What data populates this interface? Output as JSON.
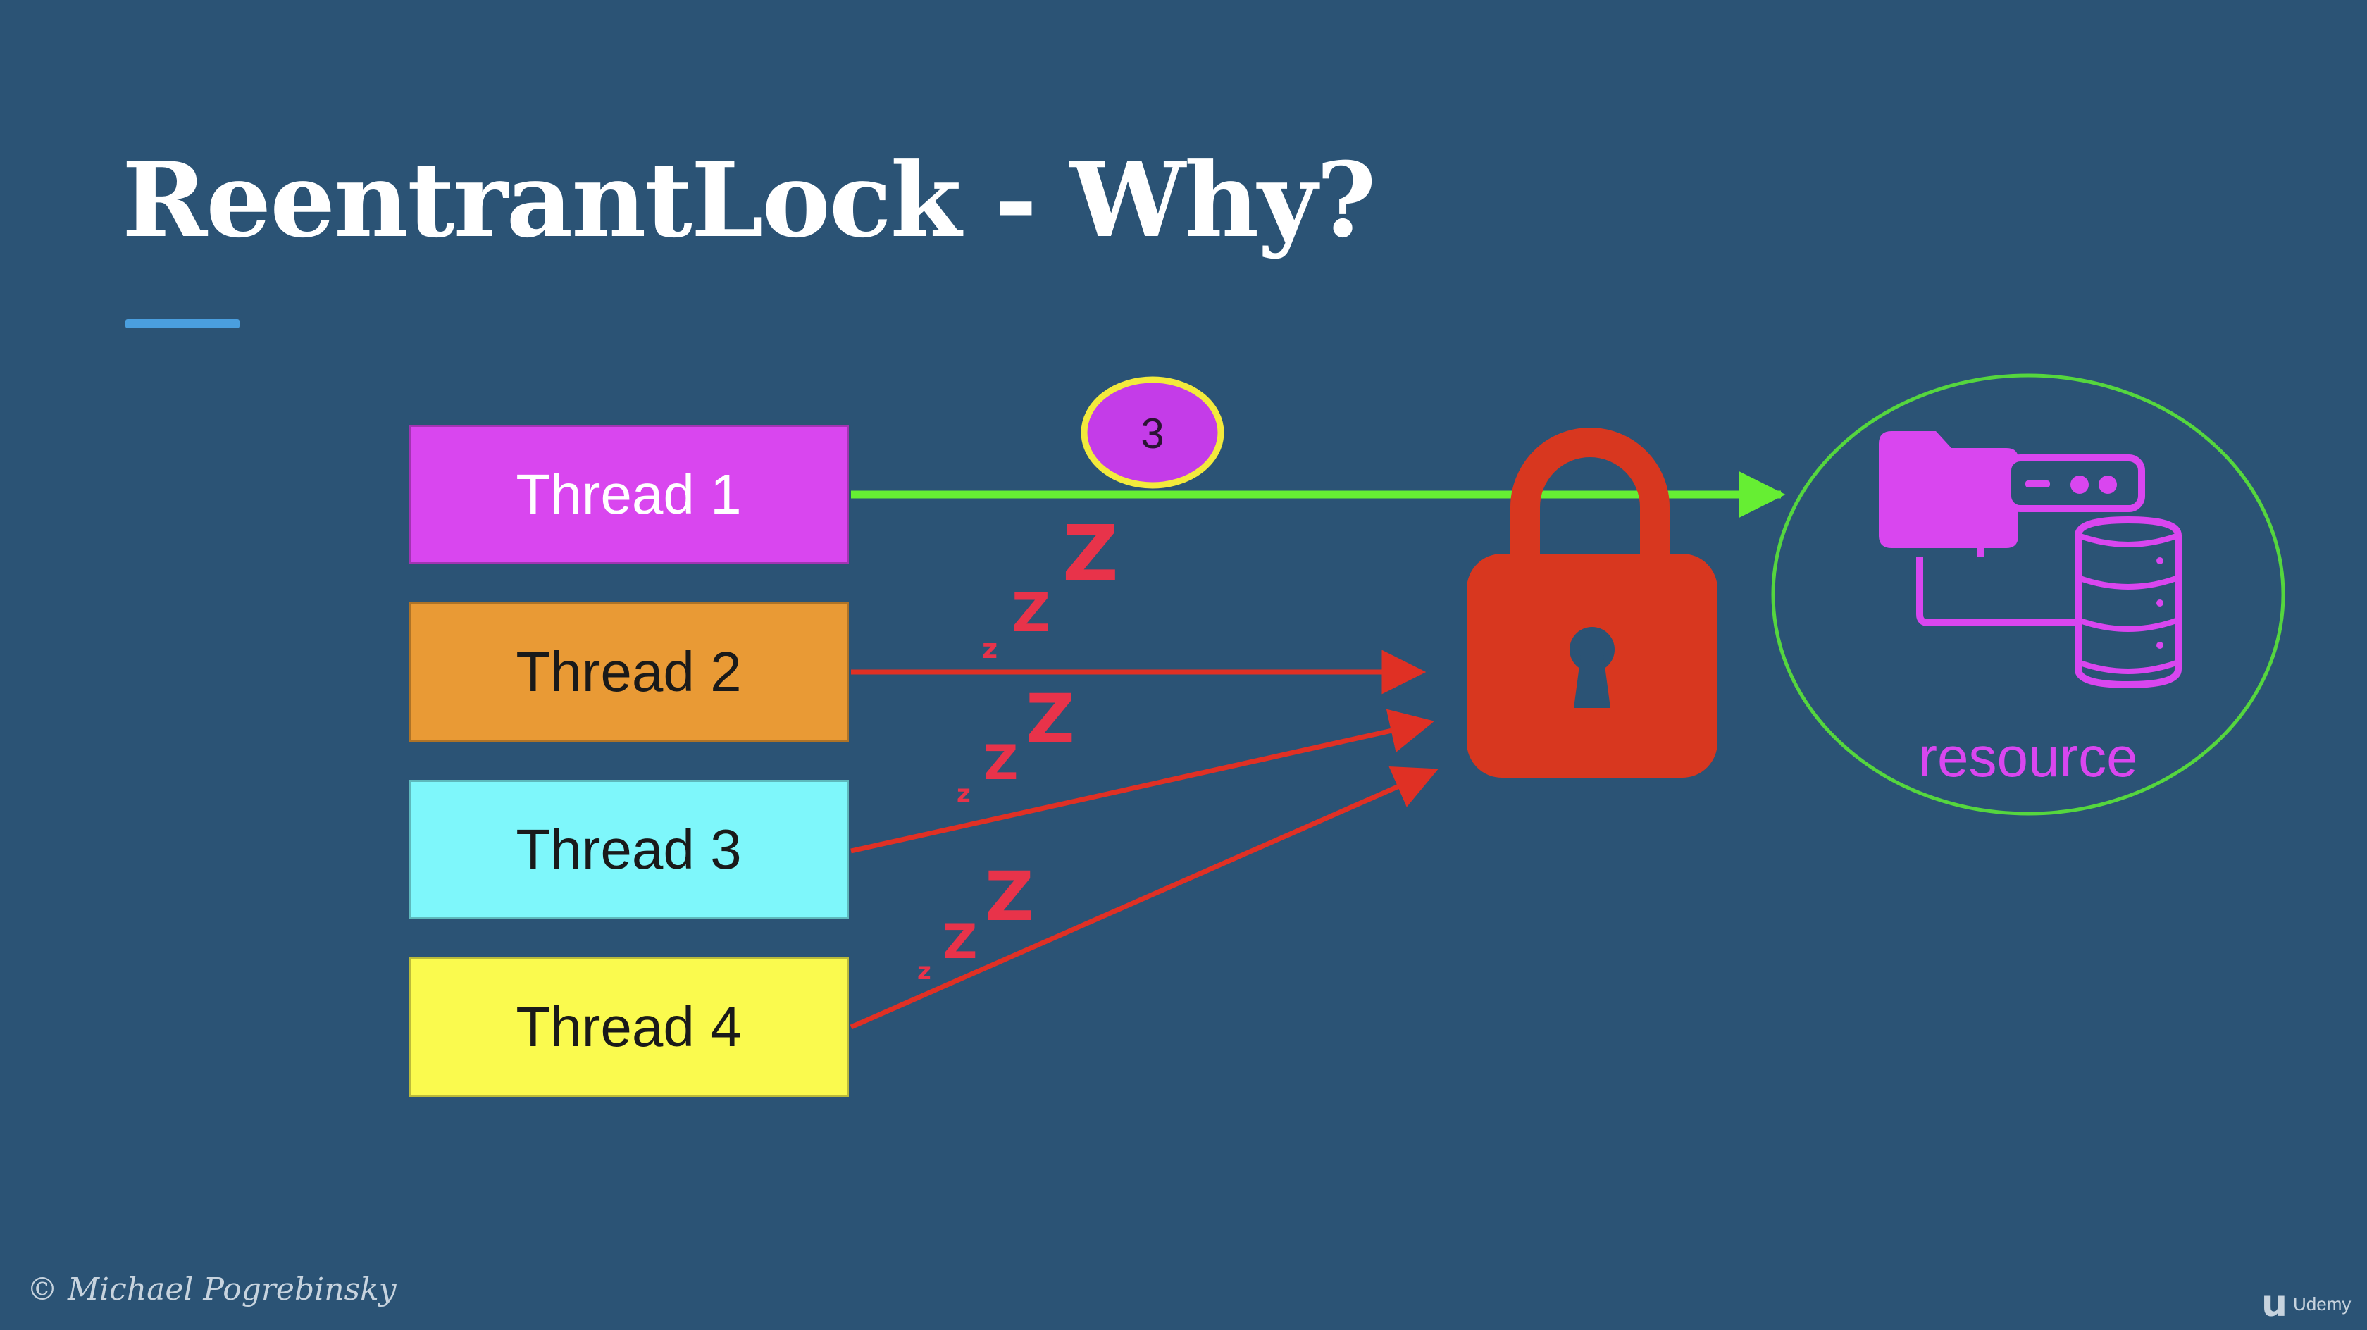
{
  "slide": {
    "title": "ReentrantLock - Why?",
    "copyright": "© Michael Pogrebinsky",
    "brand": "Udemy"
  },
  "threads": [
    {
      "label": "Thread 1",
      "color": "#d946ef",
      "text_color": "#ffffff",
      "status": "holding-lock"
    },
    {
      "label": "Thread 2",
      "color": "#e99a35",
      "text_color": "#1a1a1a",
      "status": "waiting"
    },
    {
      "label": "Thread 3",
      "color": "#7ef7fb",
      "text_color": "#1a1a1a",
      "status": "waiting"
    },
    {
      "label": "Thread 4",
      "color": "#fafa4e",
      "text_color": "#1a1a1a",
      "status": "waiting"
    }
  ],
  "hold_count_badge": {
    "value": "3",
    "fill": "#c43ce8",
    "stroke": "#f3ea3c"
  },
  "lock": {
    "icon": "padlock-icon",
    "color": "#d8371f"
  },
  "resource": {
    "label": "resource",
    "icon": "database-server-icon",
    "color": "#d946ef",
    "ring_color": "#55d63e"
  },
  "colors": {
    "background": "#2b5375",
    "acquire_arrow": "#66ee33",
    "blocked_arrow": "#e03024",
    "sleep_z": "#e8334a",
    "accent_underline": "#4a9fdf"
  }
}
